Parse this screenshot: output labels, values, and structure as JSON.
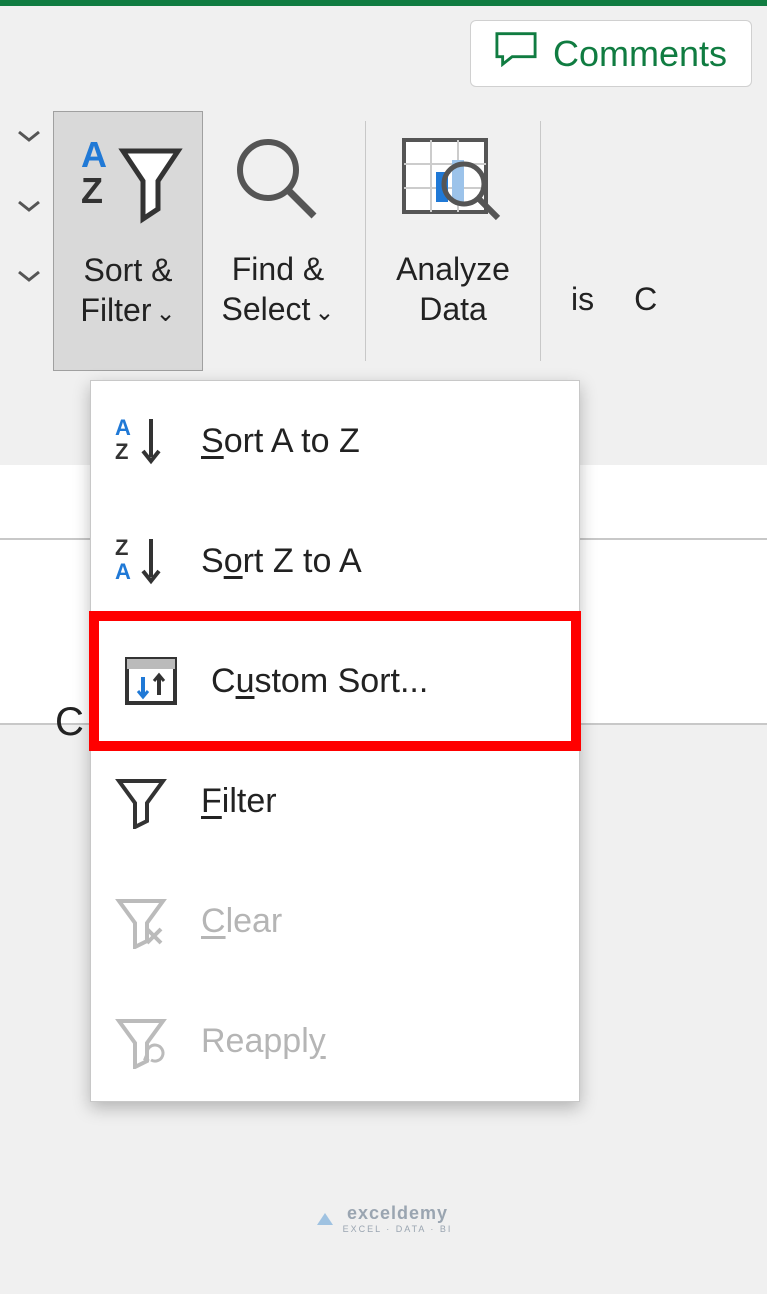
{
  "comments_label": "Comments",
  "ribbon": {
    "sort_filter": "Sort &\nFilter",
    "find_select": "Find &\nSelect",
    "analyze_data": "Analyze\nData",
    "peek1": "is",
    "peek2": "C"
  },
  "menu": {
    "sort_az": "Sort A to Z",
    "sort_za": "Sort Z to A",
    "custom_sort": "Custom Sort...",
    "filter": "Filter",
    "clear": "Clear",
    "reapply": "Reapply"
  },
  "sheet_cell": "C",
  "watermark": "exceldemy",
  "watermark_sub": "EXCEL · DATA · BI"
}
